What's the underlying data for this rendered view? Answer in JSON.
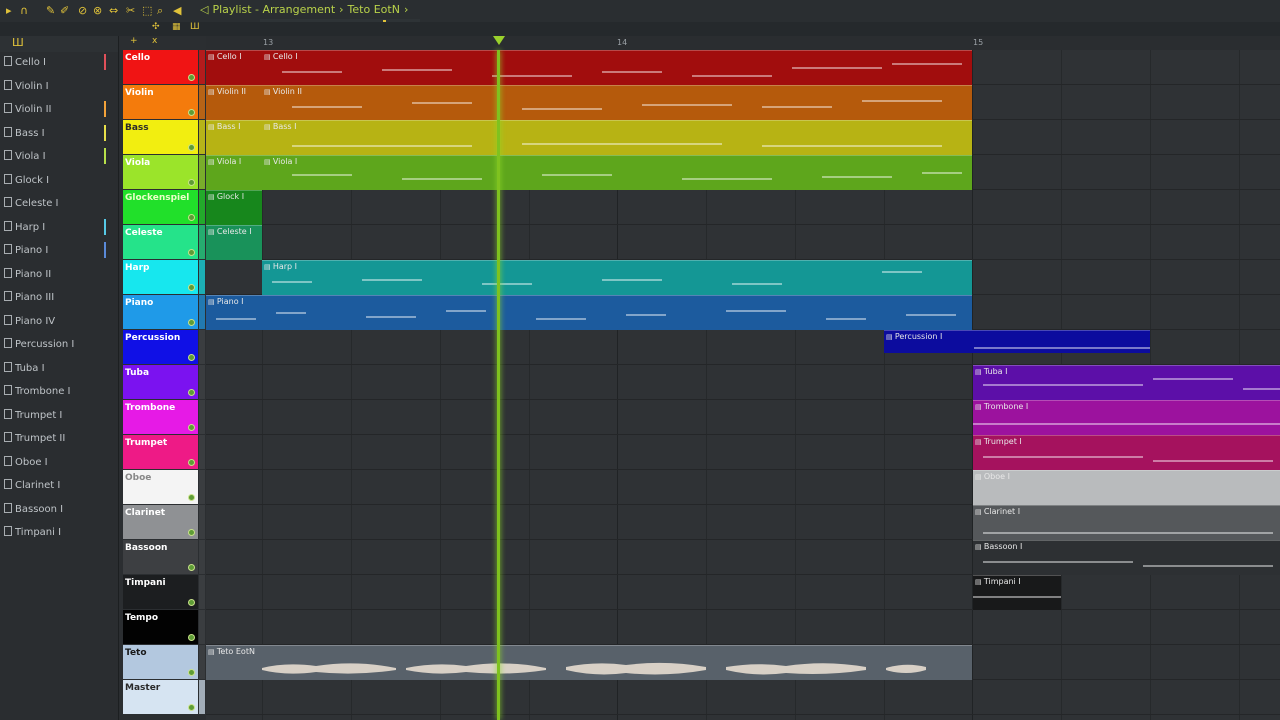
{
  "breadcrumb": {
    "items": [
      "Playlist - Arrangement",
      "›",
      "Teto EotN",
      "›"
    ]
  },
  "ruler": {
    "bars": [
      "13",
      "14",
      "15"
    ]
  },
  "picker": {
    "items": [
      {
        "label": "Cello I",
        "color": "#e0505a"
      },
      {
        "label": "Violin I",
        "color": ""
      },
      {
        "label": "Violin II",
        "color": "#f2a23a"
      },
      {
        "label": "Bass I",
        "color": "#e8e04a"
      },
      {
        "label": "Viola I",
        "color": "#b7e04a"
      },
      {
        "label": "Glock I",
        "color": ""
      },
      {
        "label": "Celeste I",
        "color": ""
      },
      {
        "label": "Harp I",
        "color": "#56c9e6"
      },
      {
        "label": "Piano I",
        "color": "#5a8ad8"
      },
      {
        "label": "Piano II",
        "color": ""
      },
      {
        "label": "Piano III",
        "color": ""
      },
      {
        "label": "Piano IV",
        "color": ""
      },
      {
        "label": "Percussion I",
        "color": ""
      },
      {
        "label": "Tuba I",
        "color": ""
      },
      {
        "label": "Trombone I",
        "color": ""
      },
      {
        "label": "Trumpet I",
        "color": ""
      },
      {
        "label": "Trumpet II",
        "color": ""
      },
      {
        "label": "Oboe I",
        "color": ""
      },
      {
        "label": "Clarinet I",
        "color": ""
      },
      {
        "label": "Bassoon I",
        "color": ""
      },
      {
        "label": "Timpani I",
        "color": ""
      }
    ]
  },
  "tracks": [
    {
      "name": "Cello",
      "color": "#f01414",
      "text": "#ffffff"
    },
    {
      "name": "Violin",
      "color": "#f47b0c",
      "text": "#ffffff"
    },
    {
      "name": "Bass",
      "color": "#f2ee10",
      "text": "#2a2a2a"
    },
    {
      "name": "Viola",
      "color": "#9be42a",
      "text": "#ffffff"
    },
    {
      "name": "Glockenspiel",
      "color": "#21e02a",
      "text": "#eaffc8"
    },
    {
      "name": "Celeste",
      "color": "#25e38a",
      "text": "#ffffff"
    },
    {
      "name": "Harp",
      "color": "#17e7ee",
      "text": "#ffffff"
    },
    {
      "name": "Piano",
      "color": "#1f9ae8",
      "text": "#ffffff"
    },
    {
      "name": "Percussion",
      "color": "#1010e6",
      "text": "#ffffff"
    },
    {
      "name": "Tuba",
      "color": "#7b12f0",
      "text": "#ffffff"
    },
    {
      "name": "Trombone",
      "color": "#e61ae6",
      "text": "#ffffff"
    },
    {
      "name": "Trumpet",
      "color": "#ee1a86",
      "text": "#ffffff"
    },
    {
      "name": "Oboe",
      "color": "#f4f4f4",
      "text": "#888888"
    },
    {
      "name": "Clarinet",
      "color": "#8f9194",
      "text": "#ffffff"
    },
    {
      "name": "Bassoon",
      "color": "#3d3f42",
      "text": "#ffffff"
    },
    {
      "name": "Timpani",
      "color": "#1c1e20",
      "text": "#ffffff"
    },
    {
      "name": "Tempo",
      "color": "#020202",
      "text": "#ffffff"
    },
    {
      "name": "Teto",
      "color": "#b3c8df",
      "text": "#1a1a1a"
    },
    {
      "name": "Master",
      "color": "#d6e4f2",
      "text": "#2a2a2a"
    }
  ],
  "clips": {
    "cello_a": "Cello I",
    "cello_b": "Cello I",
    "violin_a": "Violin II",
    "violin_b": "Violin II",
    "bass_a": "Bass I",
    "bass_b": "Bass I",
    "viola_a": "Viola I",
    "viola_b": "Viola I",
    "glock": "Glock I",
    "celeste": "Celeste I",
    "harp": "Harp I",
    "piano": "Piano I",
    "percussion": "Percussion I",
    "tuba": "Tuba I",
    "trombone": "Trombone I",
    "trumpet": "Trumpet I",
    "oboe": "Oboe I",
    "clarinet": "Clarinet I",
    "bassoon": "Bassoon I",
    "timpani": "Timpani I",
    "audio": "Teto EotN"
  },
  "colors": {
    "cello_clip": "#a10d0d",
    "violin_clip": "#b55a0c",
    "bass_clip": "#b7b314",
    "viola_clip": "#5ea61c",
    "glock_clip": "#17871c",
    "celeste_clip": "#19925a",
    "harp_clip": "#149795",
    "piano_clip": "#1c5b9e",
    "percussion_clip": "#0c0c9e",
    "tuba_clip": "#5c0fa8",
    "trombone_clip": "#9c129e",
    "trumpet_clip": "#a5125e",
    "oboe_clip": "#b9bbbd",
    "clarinet_clip": "#55585b",
    "bassoon_clip": "#2d3033",
    "timpani_clip": "#18191a",
    "audio_clip": "#58616a",
    "playhead": "#7fc21f"
  }
}
